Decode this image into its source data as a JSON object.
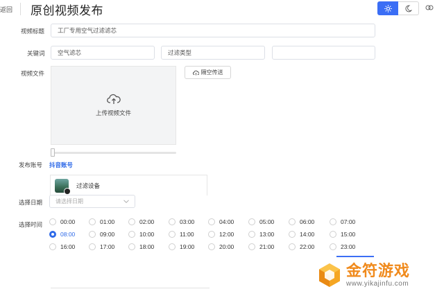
{
  "header": {
    "back_label": "返回",
    "title": "原创视频发布"
  },
  "form": {
    "title_label": "视频标题",
    "title_value": "工厂专用空气过滤滤芯",
    "keywords_label": "关键词",
    "keywords": [
      "空气滤芯",
      "过滤类型",
      ""
    ],
    "video_label": "视频文件",
    "upload_label": "上传视频文件",
    "airdrop_label": "隔空传送",
    "account_label": "发布账号",
    "account_link": "抖音账号",
    "account_name": "过滤设备",
    "date_label": "选择日期",
    "date_placeholder": "请选择日期",
    "time_label": "选择时间",
    "times": [
      "00:00",
      "01:00",
      "02:00",
      "03:00",
      "04:00",
      "05:00",
      "06:00",
      "07:00",
      "08:00",
      "09:00",
      "10:00",
      "11:00",
      "12:00",
      "13:00",
      "14:00",
      "15:00",
      "16:00",
      "17:00",
      "18:00",
      "19:00",
      "20:00",
      "21:00",
      "22:00",
      "23:00"
    ],
    "selected_time": "08:00"
  },
  "watermark": {
    "title": "金符游戏",
    "url": "www.yikajinfu.com"
  },
  "colors": {
    "accent": "#3b6ef5",
    "link": "#2f6ae8",
    "watermark": "#f08a1c"
  }
}
